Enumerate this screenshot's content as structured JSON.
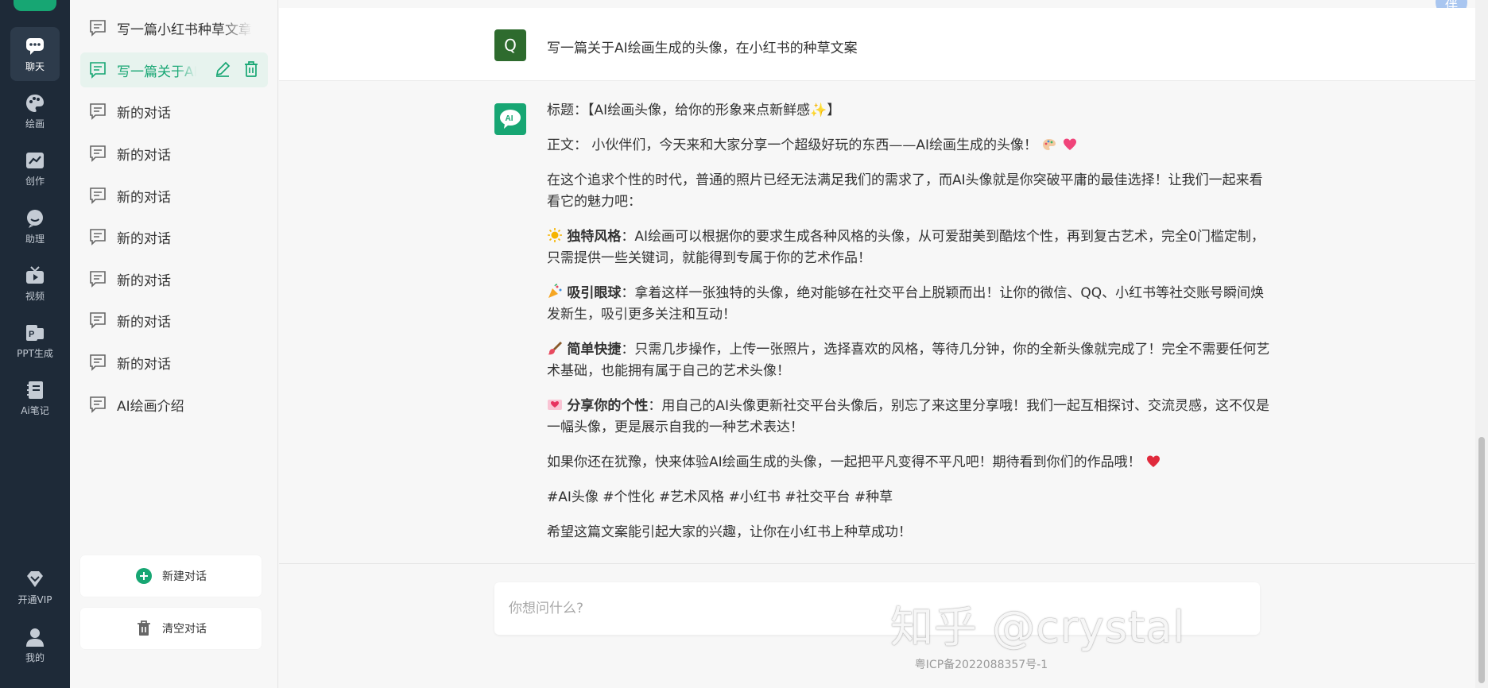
{
  "nav": {
    "items": [
      {
        "label": "聊天",
        "icon": "chat-bubble-icon",
        "active": true
      },
      {
        "label": "绘画",
        "icon": "palette-icon"
      },
      {
        "label": "创作",
        "icon": "chart-trend-icon"
      },
      {
        "label": "助理",
        "icon": "assistant-face-icon"
      },
      {
        "label": "视频",
        "icon": "tv-icon"
      },
      {
        "label": "PPT生成",
        "icon": "ppt-icon"
      },
      {
        "label": "Ai笔记",
        "icon": "notebook-icon"
      },
      {
        "label": "开通VIP",
        "icon": "diamond-icon"
      },
      {
        "label": "我的",
        "icon": "user-icon"
      }
    ]
  },
  "sidebar": {
    "conversations": [
      {
        "title": "写一篇小红书种草文章"
      },
      {
        "title": "写一篇关于AI绘画生成的头像",
        "active": true
      },
      {
        "title": "新的对话"
      },
      {
        "title": "新的对话"
      },
      {
        "title": "新的对话"
      },
      {
        "title": "新的对话"
      },
      {
        "title": "新的对话"
      },
      {
        "title": "新的对话"
      },
      {
        "title": "新的对话"
      },
      {
        "title": "AI绘画介绍"
      }
    ],
    "new_chat_label": "新建对话",
    "clear_chat_label": "清空对话"
  },
  "chat": {
    "question_avatar": "Q",
    "question": "写一篇关于AI绘画生成的头像，在小红书的种草文案",
    "answer": {
      "title": "标题：【AI绘画头像，给你的形象来点新鲜感✨】",
      "body_intro": "正文： 小伙伴们，今天来和大家分享一个超级好玩的东西——AI绘画生成的头像！",
      "para1": "在这个追求个性的时代，普通的照片已经无法满足我们的需求了，而AI头像就是你突破平庸的最佳选择！让我们一起来看看它的魅力吧：",
      "f1_title": "独特风格",
      "f1_text": "：AI绘画可以根据你的要求生成各种风格的头像，从可爱甜美到酷炫个性，再到复古艺术，完全0门槛定制，只需提供一些关键词，就能得到专属于你的艺术作品！",
      "f2_title": "吸引眼球",
      "f2_text": "：拿着这样一张独特的头像，绝对能够在社交平台上脱颖而出！让你的微信、QQ、小红书等社交账号瞬间焕发新生，吸引更多关注和互动！",
      "f3_title": "简单快捷",
      "f3_text": "：只需几步操作，上传一张照片，选择喜欢的风格，等待几分钟，你的全新头像就完成了！完全不需要任何艺术基础，也能拥有属于自己的艺术头像！",
      "f4_title": "分享你的个性",
      "f4_text": "：用自己的AI头像更新社交平台头像后，别忘了来这里分享哦！我们一起互相探讨、交流灵感，这不仅是一幅头像，更是展示自我的一种艺术表达！",
      "para_end": "如果你还在犹豫，快来体验AI绘画生成的头像，一起把平凡变得不平凡吧！期待看到你们的作品哦！",
      "tags": "#AI头像 #个性化 #艺术风格 #小红书 #社交平台 #种草",
      "closing": "希望这篇文案能引起大家的兴趣，让你在小红书上种草成功！"
    },
    "input_placeholder": "你想问什么?",
    "top_badge": "伴"
  },
  "footer": "粤ICP备2022088357号-1",
  "watermark": "知乎 @crystal",
  "colors": {
    "accent": "#17a673",
    "rail": "#1e2a38",
    "user_avatar": "#2e6b2e"
  }
}
